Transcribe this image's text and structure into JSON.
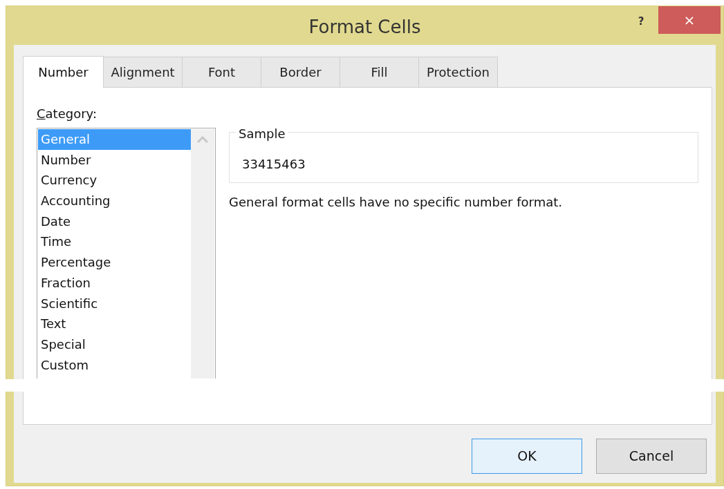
{
  "window": {
    "title": "Format Cells",
    "help": "?",
    "close": "×"
  },
  "tabs": [
    {
      "label": "Number",
      "selected": true
    },
    {
      "label": "Alignment",
      "selected": false
    },
    {
      "label": "Font",
      "selected": false
    },
    {
      "label": "Border",
      "selected": false
    },
    {
      "label": "Fill",
      "selected": false
    },
    {
      "label": "Protection",
      "selected": false
    }
  ],
  "category": {
    "label": "Category:",
    "items": [
      {
        "label": "General",
        "selected": true
      },
      {
        "label": "Number",
        "selected": false
      },
      {
        "label": "Currency",
        "selected": false
      },
      {
        "label": "Accounting",
        "selected": false
      },
      {
        "label": "Date",
        "selected": false
      },
      {
        "label": "Time",
        "selected": false
      },
      {
        "label": "Percentage",
        "selected": false
      },
      {
        "label": "Fraction",
        "selected": false
      },
      {
        "label": "Scientific",
        "selected": false
      },
      {
        "label": "Text",
        "selected": false
      },
      {
        "label": "Special",
        "selected": false
      },
      {
        "label": "Custom",
        "selected": false
      }
    ]
  },
  "sample": {
    "label": "Sample",
    "value": "33415463"
  },
  "description": "General format cells have no specific number format.",
  "buttons": [
    {
      "label": "OK",
      "default": true
    },
    {
      "label": "Cancel",
      "default": false
    }
  ]
}
